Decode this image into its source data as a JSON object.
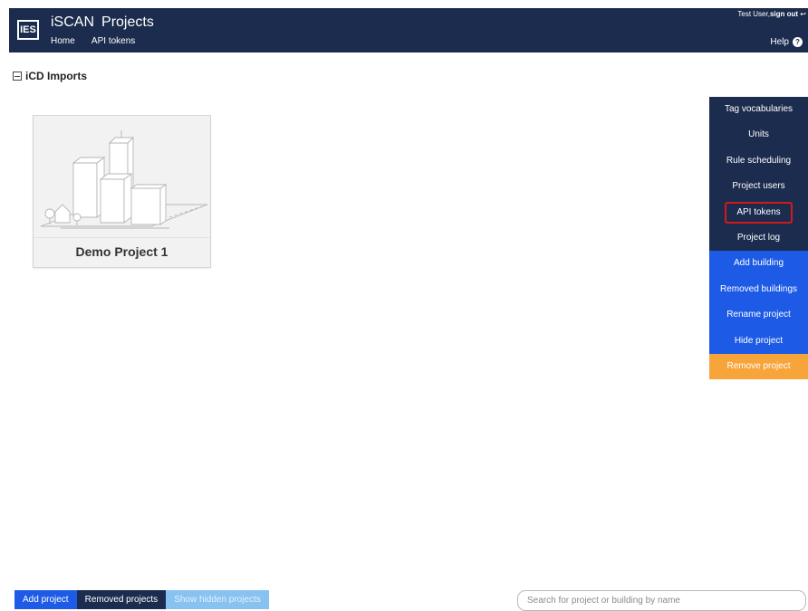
{
  "header": {
    "logo_text": "IES",
    "app_name": "iSCAN",
    "page_name": "Projects",
    "nav": [
      "Home",
      "API tokens"
    ],
    "user_text": "Test User,",
    "signout_text": "sign out",
    "signout_glyph": "↩",
    "help_label": "Help",
    "help_icon_glyph": "?"
  },
  "section": {
    "title": "iCD Imports"
  },
  "projects": [
    {
      "name": "Demo Project 1"
    }
  ],
  "side_menu": {
    "items": [
      {
        "label": "Tag vocabularies",
        "style": "dark"
      },
      {
        "label": "Units",
        "style": "dark"
      },
      {
        "label": "Rule scheduling",
        "style": "dark"
      },
      {
        "label": "Project users",
        "style": "dark"
      },
      {
        "label": "API tokens",
        "style": "dark",
        "highlighted": true
      },
      {
        "label": "Project log",
        "style": "dark"
      },
      {
        "label": "Add building",
        "style": "blue"
      },
      {
        "label": "Removed buildings",
        "style": "blue"
      },
      {
        "label": "Rename project",
        "style": "blue"
      },
      {
        "label": "Hide project",
        "style": "blue"
      },
      {
        "label": "Remove project",
        "style": "orange"
      }
    ]
  },
  "footer": {
    "add_project": "Add project",
    "removed_projects": "Removed projects",
    "show_hidden": "Show hidden projects",
    "search_placeholder": "Search for project or building by name"
  },
  "colors": {
    "navy": "#1c2c4e",
    "blue": "#1d5be6",
    "light_blue": "#87c2f1",
    "orange": "#f7a43a",
    "highlight_red": "#d11a1a"
  }
}
